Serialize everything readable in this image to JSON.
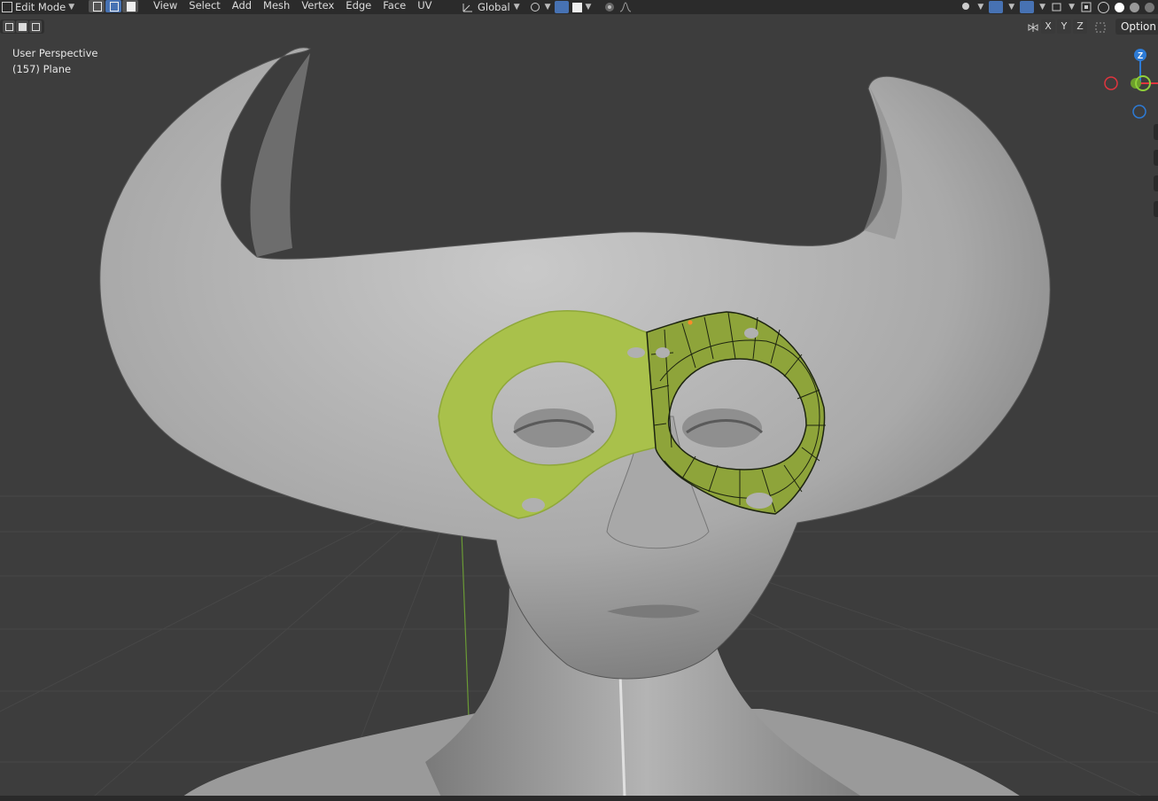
{
  "header": {
    "mode": "Edit Mode",
    "menus": [
      "View",
      "Select",
      "Add",
      "Mesh",
      "Vertex",
      "Edge",
      "Face",
      "UV"
    ],
    "orientation": "Global",
    "options_label": "Option",
    "axes": [
      "X",
      "Y",
      "Z"
    ]
  },
  "viewport": {
    "view_name": "User Perspective",
    "object_label": "(157) Plane"
  },
  "gizmo": {
    "z_label": "Z",
    "colors": {
      "x": "#e0353e",
      "y": "#6da02b",
      "z": "#2d7bd6"
    }
  },
  "colors": {
    "background": "#3d3d3d",
    "mesh": "#b8b8b8",
    "mask_fill": "#a8c04a",
    "mask_fill_selected": "#8ea43a",
    "active_blue": "#4772b3"
  }
}
